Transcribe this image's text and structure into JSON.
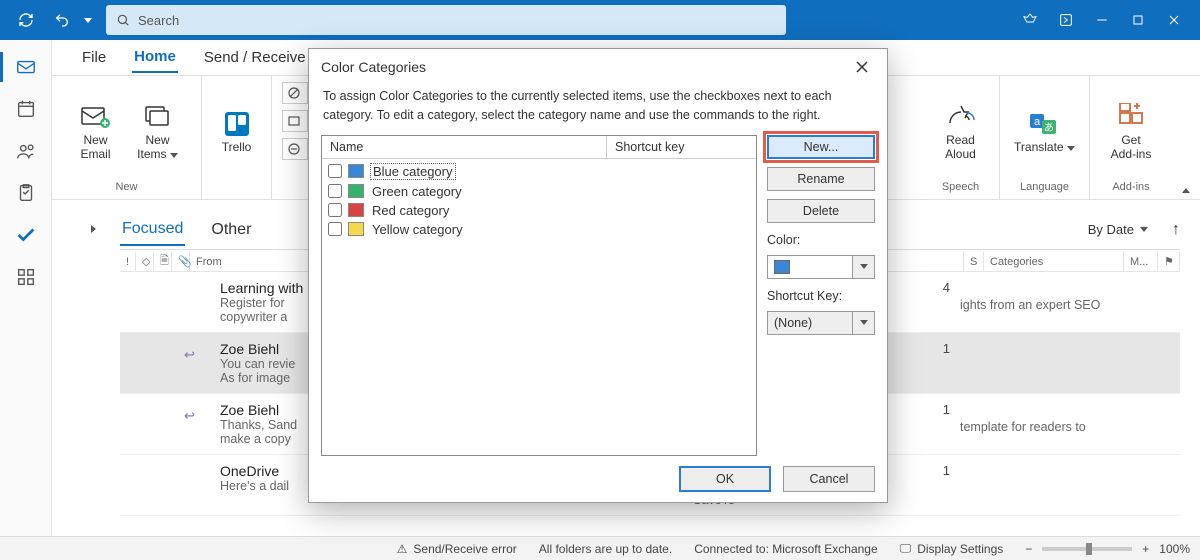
{
  "search": {
    "placeholder": "Search"
  },
  "ribbon": {
    "tabs": {
      "file": "File",
      "home": "Home",
      "send": "Send / Receive"
    },
    "buttons": {
      "new_email": "New\nEmail",
      "new_items": "New\nItems",
      "trello": "Trello",
      "read_aloud": "Read\nAloud",
      "translate": "Translate",
      "get_addins": "Get\nAdd-ins"
    },
    "groups": {
      "new": "New",
      "speech": "Speech",
      "language": "Language",
      "addins": "Add-ins"
    }
  },
  "content_tabs": {
    "focused": "Focused",
    "other": "Other"
  },
  "sort": {
    "by_date": "By Date"
  },
  "colhead": {
    "from": "From",
    "s": "S",
    "categories": "Categories",
    "m": "M..."
  },
  "messages": [
    {
      "from": "Learning with Experts",
      "l1": "Register for",
      "l2": "copywriter a",
      "count": "4",
      "extra": "ights from an expert SEO"
    },
    {
      "from": "Zoe Biehl",
      "l1": "You can revie",
      "l2": "As for image",
      "count": "1",
      "reply": true
    },
    {
      "from": "Zoe Biehl",
      "l1": "Thanks, Sand",
      "l2": "make a copy",
      "count": "1",
      "extra": "template for readers to",
      "reply": true
    },
    {
      "from": "OneDrive",
      "l1": "Here's a dail",
      "l2": "SaveTe",
      "count": "1"
    }
  ],
  "dialog": {
    "title": "Color Categories",
    "intro": "To assign Color Categories to the currently selected items, use the checkboxes next to each category.  To edit a category, select the category name and use the commands to the right.",
    "headers": {
      "name": "Name",
      "shortcut": "Shortcut key"
    },
    "categories": [
      {
        "label": "Blue category",
        "color": "#3a87d6"
      },
      {
        "label": "Green category",
        "color": "#33b36b"
      },
      {
        "label": "Red category",
        "color": "#d64545"
      },
      {
        "label": "Yellow category",
        "color": "#f4d94d"
      }
    ],
    "buttons": {
      "new": "New...",
      "rename": "Rename",
      "delete": "Delete",
      "ok": "OK",
      "cancel": "Cancel"
    },
    "labels": {
      "color": "Color:",
      "shortcut": "Shortcut Key:"
    },
    "shortcut_value": "(None)",
    "selected_color": "#3a87d6"
  },
  "status": {
    "err": "Send/Receive error",
    "folders": "All folders are up to date.",
    "conn": "Connected to: Microsoft Exchange",
    "display": "Display Settings",
    "zoom": "100%"
  }
}
